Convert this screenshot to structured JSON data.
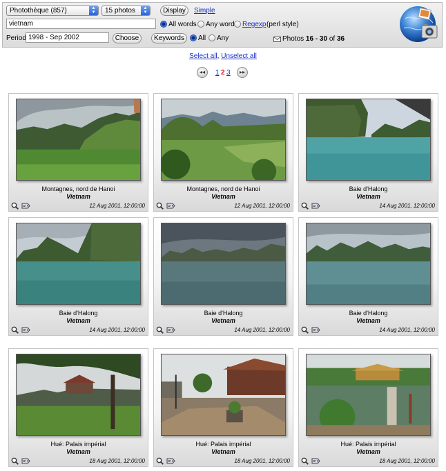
{
  "search": {
    "album_select": "Photothèque (857)",
    "per_page_select": "15 photos",
    "display_button": "Display",
    "simple_link": "Simple",
    "query_value": "vietnam",
    "match_all_words": "All words",
    "match_any_word": "Any word",
    "regexp_link": "Regexp",
    "regexp_note": "(perl style)",
    "period_label": "Period",
    "period_value": "1998 - Sep 2002",
    "choose_button": "Choose",
    "keywords_button": "Keywords",
    "kw_all": "All",
    "kw_any": "Any",
    "summary": {
      "prefix": "Photos",
      "range": "16 - 30",
      "of": "of",
      "total": "36"
    }
  },
  "selection": {
    "select_all": "Select all",
    "separator": ",",
    "unselect_all": "Unselect all"
  },
  "pager": {
    "pages": [
      "1",
      "2",
      "3"
    ],
    "current": "2"
  },
  "photos": [
    {
      "title": "Montagnes, nord de Hanoi",
      "place": "Vietnam",
      "date": "12 Aug 2001, 12:00:00",
      "scene": "mountain-valley"
    },
    {
      "title": "Montagnes, nord de Hanoi",
      "place": "Vietnam",
      "date": "12 Aug 2001, 12:00:00",
      "scene": "hills-fields"
    },
    {
      "title": "Baie d'Halong",
      "place": "Vietnam",
      "date": "14 Aug 2001, 12:00:00",
      "scene": "bay-cliff"
    },
    {
      "title": "Baie d'Halong",
      "place": "Vietnam",
      "date": "14 Aug 2001, 12:00:00",
      "scene": "bay-islands"
    },
    {
      "title": "Baie d'Halong",
      "place": "Vietnam",
      "date": "14 Aug 2001, 12:00:00",
      "scene": "bay-stormy"
    },
    {
      "title": "Baie d'Halong",
      "place": "Vietnam",
      "date": "14 Aug 2001, 12:00:00",
      "scene": "bay-wide"
    },
    {
      "title": "Hué: Palais impérial",
      "place": "Vietnam",
      "date": "18 Aug 2001, 12:00:00",
      "scene": "palace-tree"
    },
    {
      "title": "Hué: Palais impérial",
      "place": "Vietnam",
      "date": "18 Aug 2001, 12:00:00",
      "scene": "palace-courtyard"
    },
    {
      "title": "Hué: Palais impérial",
      "place": "Vietnam",
      "date": "18 Aug 2001, 12:00:00",
      "scene": "palace-pond"
    }
  ],
  "icons": {
    "zoom": "magnifier-icon",
    "tag": "keyword-tag-icon",
    "mail": "envelope-icon",
    "logo": "photo-globe-logo"
  },
  "colors": {
    "link": "#1a2ec8",
    "current_page": "#d0161c",
    "select_arrow": "#3b72de"
  }
}
